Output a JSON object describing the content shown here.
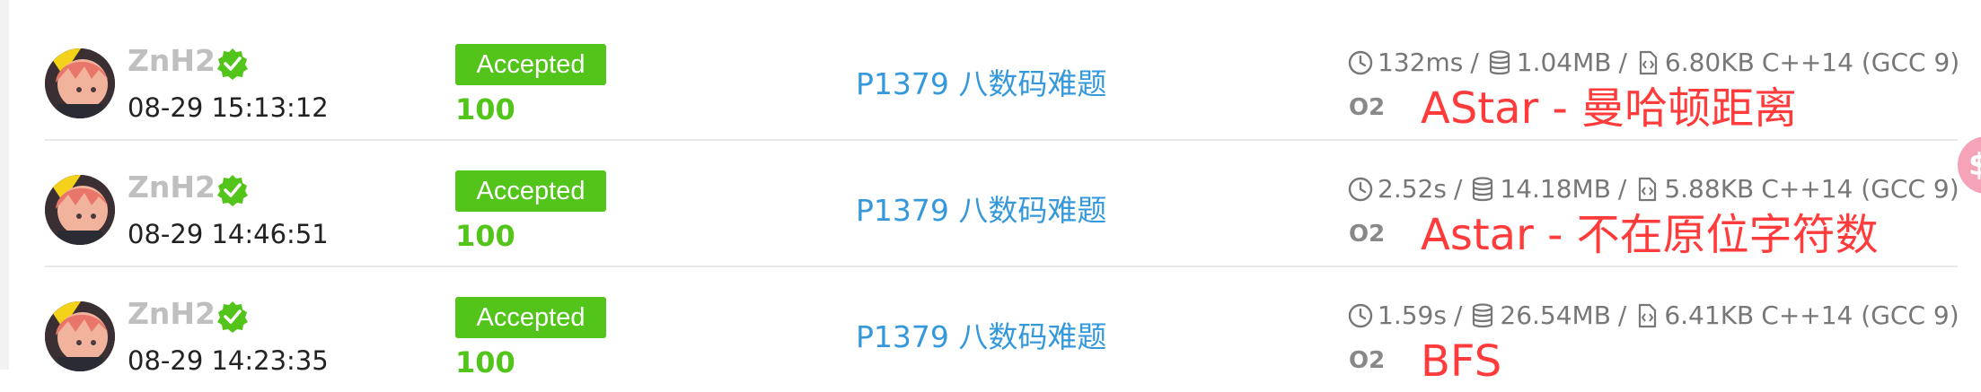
{
  "records": [
    {
      "user": "ZnH2",
      "time": "08-29 15:13:12",
      "status": "Accepted",
      "score": "100",
      "problem": "P1379 八数码难题",
      "run_time": "132ms",
      "memory": "1.04MB",
      "code_size": "6.80KB",
      "language": "C++14 (GCC 9)",
      "o2": "O2",
      "note": "AStar - 曼哈顿距离"
    },
    {
      "user": "ZnH2",
      "time": "08-29 14:46:51",
      "status": "Accepted",
      "score": "100",
      "problem": "P1379 八数码难题",
      "run_time": "2.52s",
      "memory": "14.18MB",
      "code_size": "5.88KB",
      "language": "C++14 (GCC 9)",
      "o2": "O2",
      "note": "Astar - 不在原位字符数"
    },
    {
      "user": "ZnH2",
      "time": "08-29 14:23:35",
      "status": "Accepted",
      "score": "100",
      "problem": "P1379 八数码难题",
      "run_time": "1.59s",
      "memory": "26.54MB",
      "code_size": "6.41KB",
      "language": "C++14 (GCC 9)",
      "o2": "O2",
      "note": "BFS"
    }
  ],
  "separator": "/",
  "icons": {
    "verified": "check-badge-icon",
    "time": "clock-icon",
    "memory": "database-icon",
    "code_size": "file-code-icon"
  },
  "colors": {
    "accepted": "#52c41a",
    "link": "#3498db",
    "annotation": "#ff3b3b",
    "username": "#bfbfbf"
  }
}
